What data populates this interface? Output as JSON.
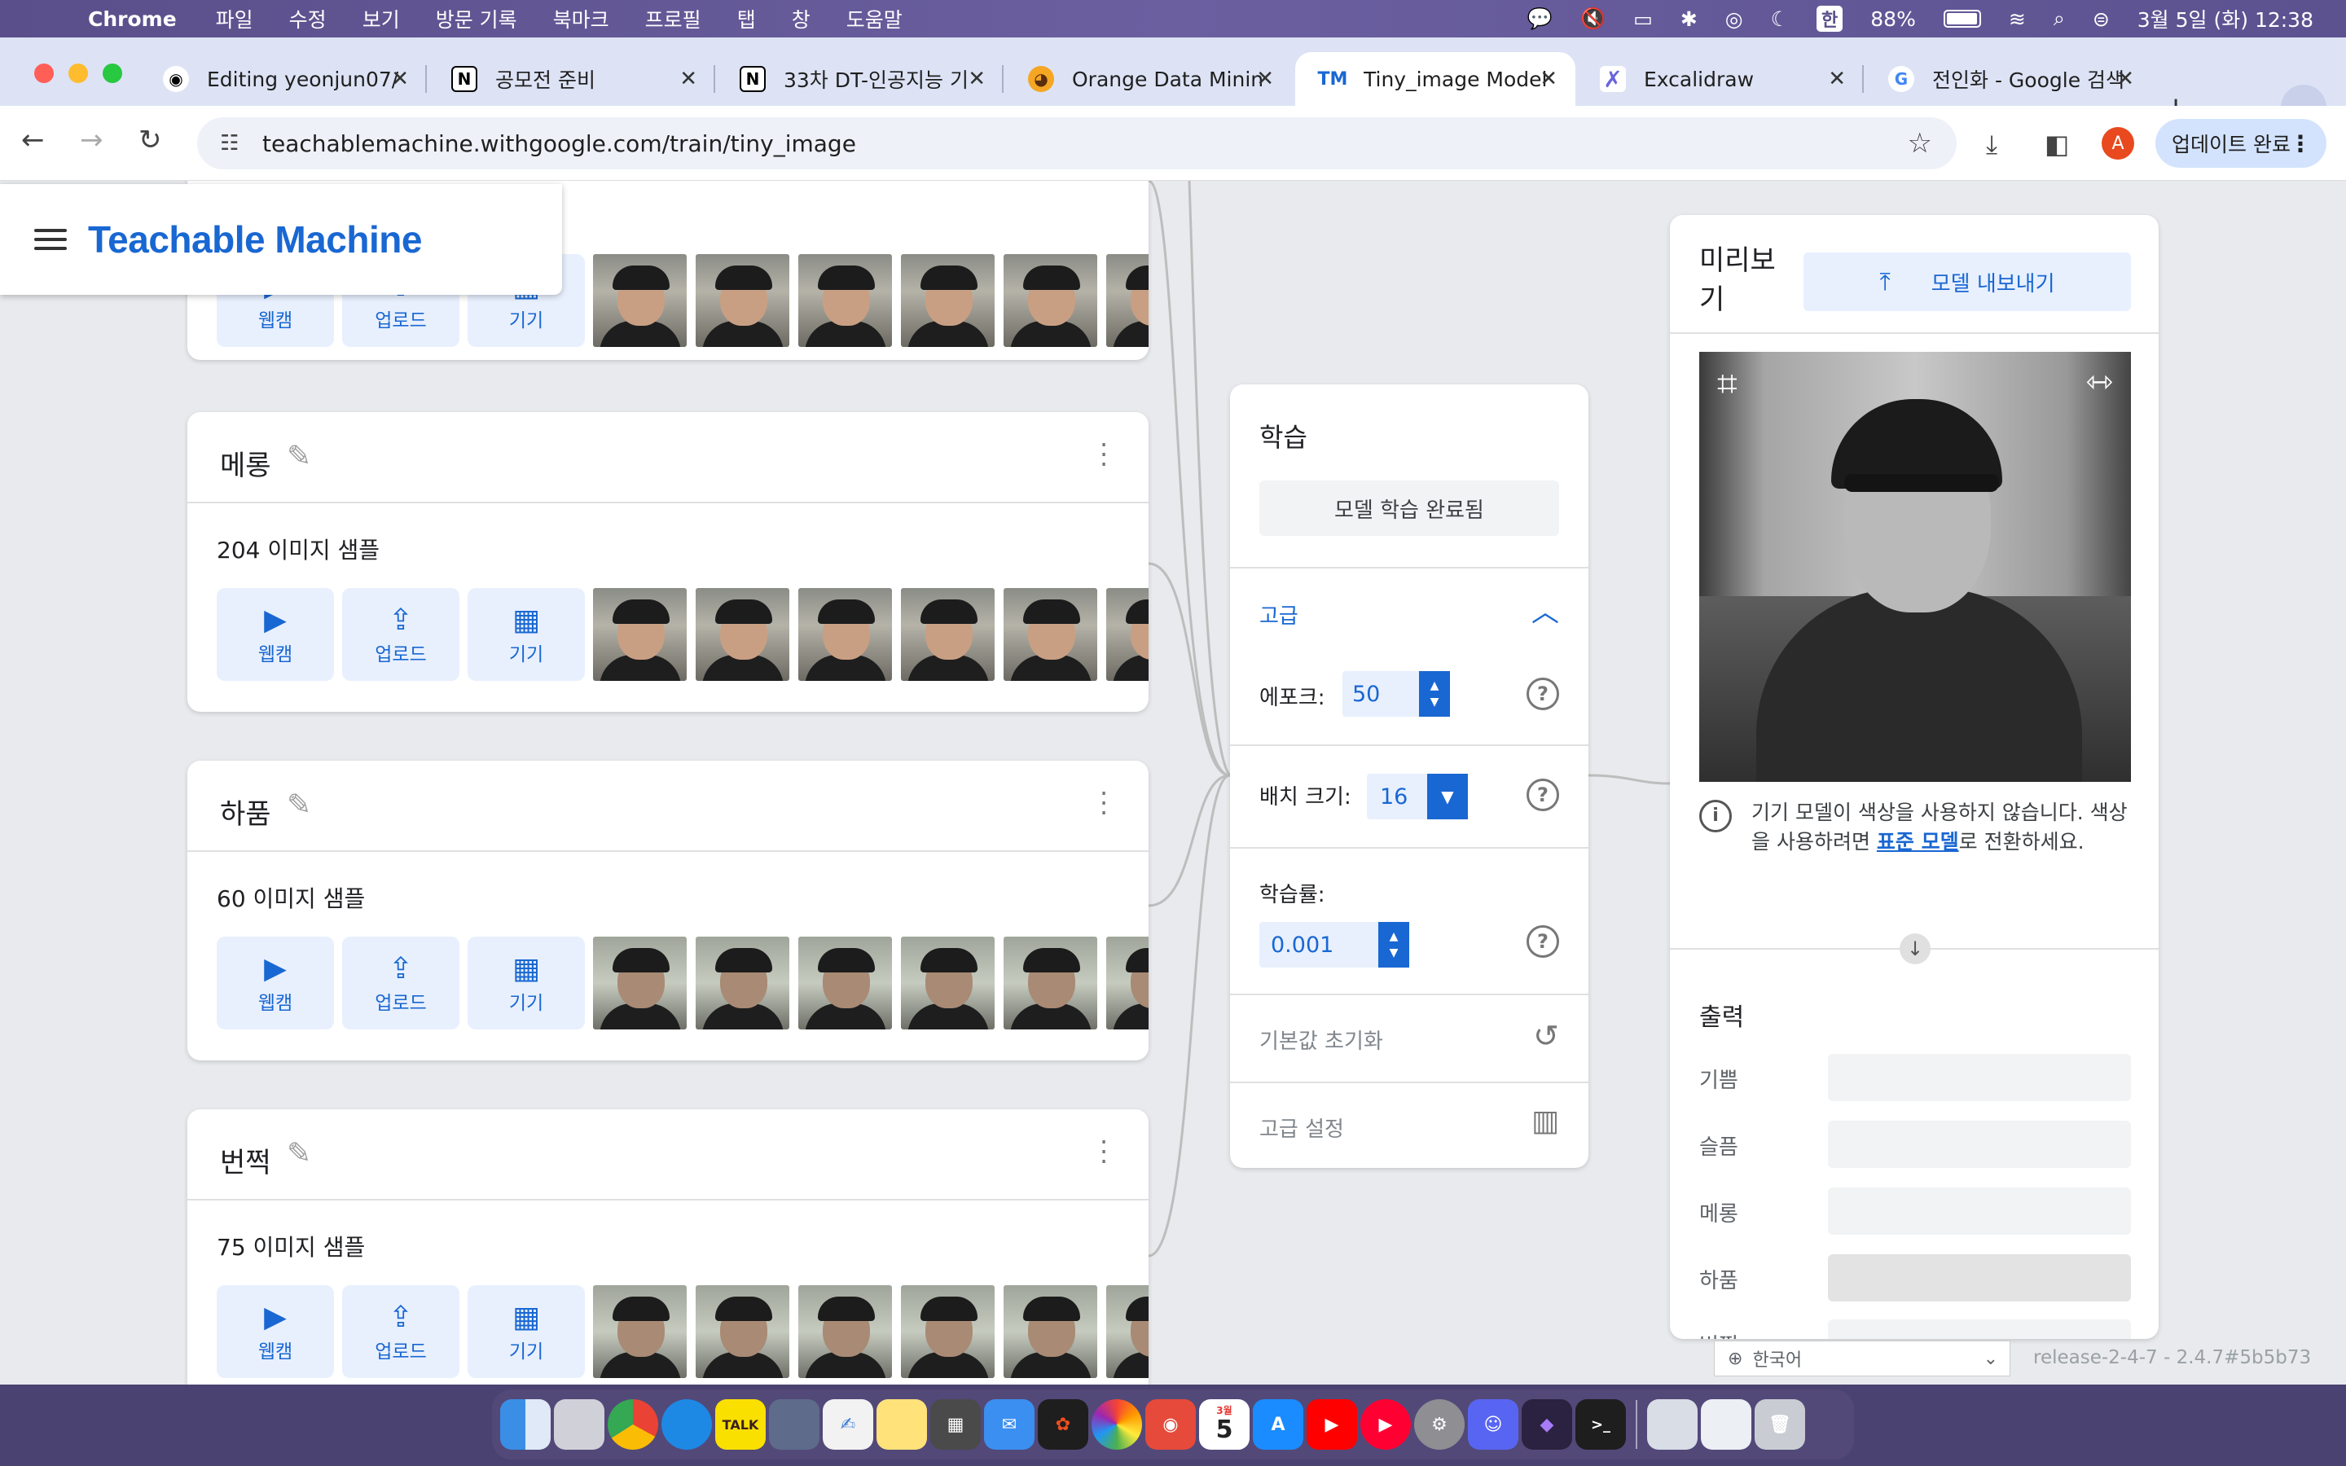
{
  "menubar": {
    "app": "Chrome",
    "items": [
      "파일",
      "수정",
      "보기",
      "방문 기록",
      "북마크",
      "프로필",
      "탭",
      "창",
      "도움말"
    ],
    "input_method": "한",
    "battery": "88%",
    "datetime": "3월 5일 (화) 12:38"
  },
  "tabs": [
    {
      "title": "Editing yeonjun07/",
      "icon": "github-icon"
    },
    {
      "title": "공모전 준비",
      "icon": "notion-icon"
    },
    {
      "title": "33차 DT-인공지능 기",
      "icon": "notion-icon"
    },
    {
      "title": "Orange Data Minin",
      "icon": "orange-icon"
    },
    {
      "title": "Tiny_image Model",
      "icon": "tm-icon",
      "active": true
    },
    {
      "title": "Excalidraw",
      "icon": "excalidraw-icon"
    },
    {
      "title": "전인화 - Google 검색",
      "icon": "google-icon"
    }
  ],
  "toolbar": {
    "url": "teachablemachine.withgoogle.com/train/tiny_image",
    "avatar_letter": "A",
    "update_label": "업데이트 완료"
  },
  "header": {
    "brand": "Teachable Machine"
  },
  "classes": [
    {
      "name": "",
      "count": "",
      "partial": true
    },
    {
      "name": "메롱",
      "count": "204 이미지 샘플"
    },
    {
      "name": "하품",
      "count": "60 이미지 샘플"
    },
    {
      "name": "번쩍",
      "count": "75 이미지 샘플"
    }
  ],
  "source_buttons": {
    "webcam": "웹캠",
    "upload": "업로드",
    "device": "기기"
  },
  "training": {
    "title": "학습",
    "train_button": "모델 학습 완료됨",
    "advanced": "고급",
    "epochs_label": "에포크:",
    "epochs_value": "50",
    "batch_label": "배치 크기:",
    "batch_value": "16",
    "lr_label": "학습률:",
    "lr_value": "0.001",
    "reset_label": "기본값 초기화",
    "advanced_settings": "고급 설정"
  },
  "preview": {
    "title": "미리보기",
    "export_label": "모델 내보내기",
    "note_prefix": "기기 모델이 색상을 사용하지 않습니다. 색상을 사용하려면 ",
    "note_link": "표준 모델",
    "note_suffix": "로 전환하세요.",
    "output_title": "출력",
    "outputs": [
      "기쁨",
      "슬픔",
      "메롱",
      "하품",
      "번쩍"
    ]
  },
  "footer": {
    "language": "한국어",
    "release": "release-2-4-7 - 2.4.7#5b5b73"
  },
  "dock": {
    "calendar_day": "5",
    "calendar_month": "3월"
  }
}
